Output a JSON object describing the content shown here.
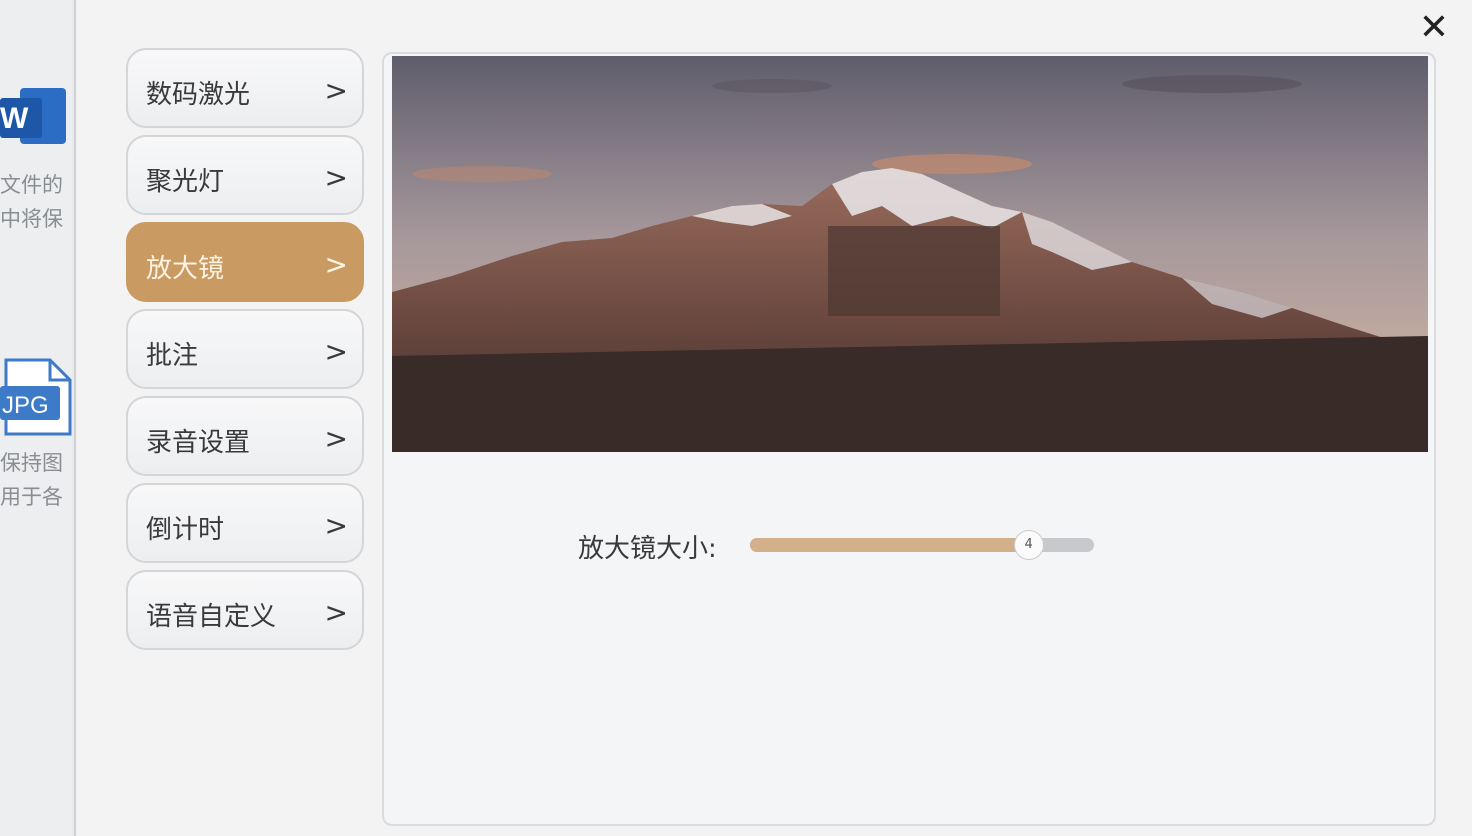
{
  "background": {
    "word_icon_letter": "W",
    "word_file_text_line1": "文件的",
    "word_file_text_line2": "中将保",
    "jpg_icon_label": "JPG",
    "jpg_file_text_line1": "保持图",
    "jpg_file_text_line2": "用于各"
  },
  "window": {
    "close_symbol": "✕"
  },
  "menu": {
    "items": [
      {
        "label": "数码激光",
        "chevron": ">"
      },
      {
        "label": "聚光灯",
        "chevron": ">"
      },
      {
        "label": "放大镜",
        "chevron": ">",
        "active": true
      },
      {
        "label": "批注",
        "chevron": ">"
      },
      {
        "label": "录音设置",
        "chevron": ">"
      },
      {
        "label": "倒计时",
        "chevron": ">"
      },
      {
        "label": "语音自定义",
        "chevron": ">"
      }
    ]
  },
  "magnifier": {
    "size_label": "放大镜大小:",
    "size_value": "4",
    "size_fraction": 0.81
  },
  "colors": {
    "accent": "#c99a62",
    "slider_fill": "#d3b08a"
  }
}
